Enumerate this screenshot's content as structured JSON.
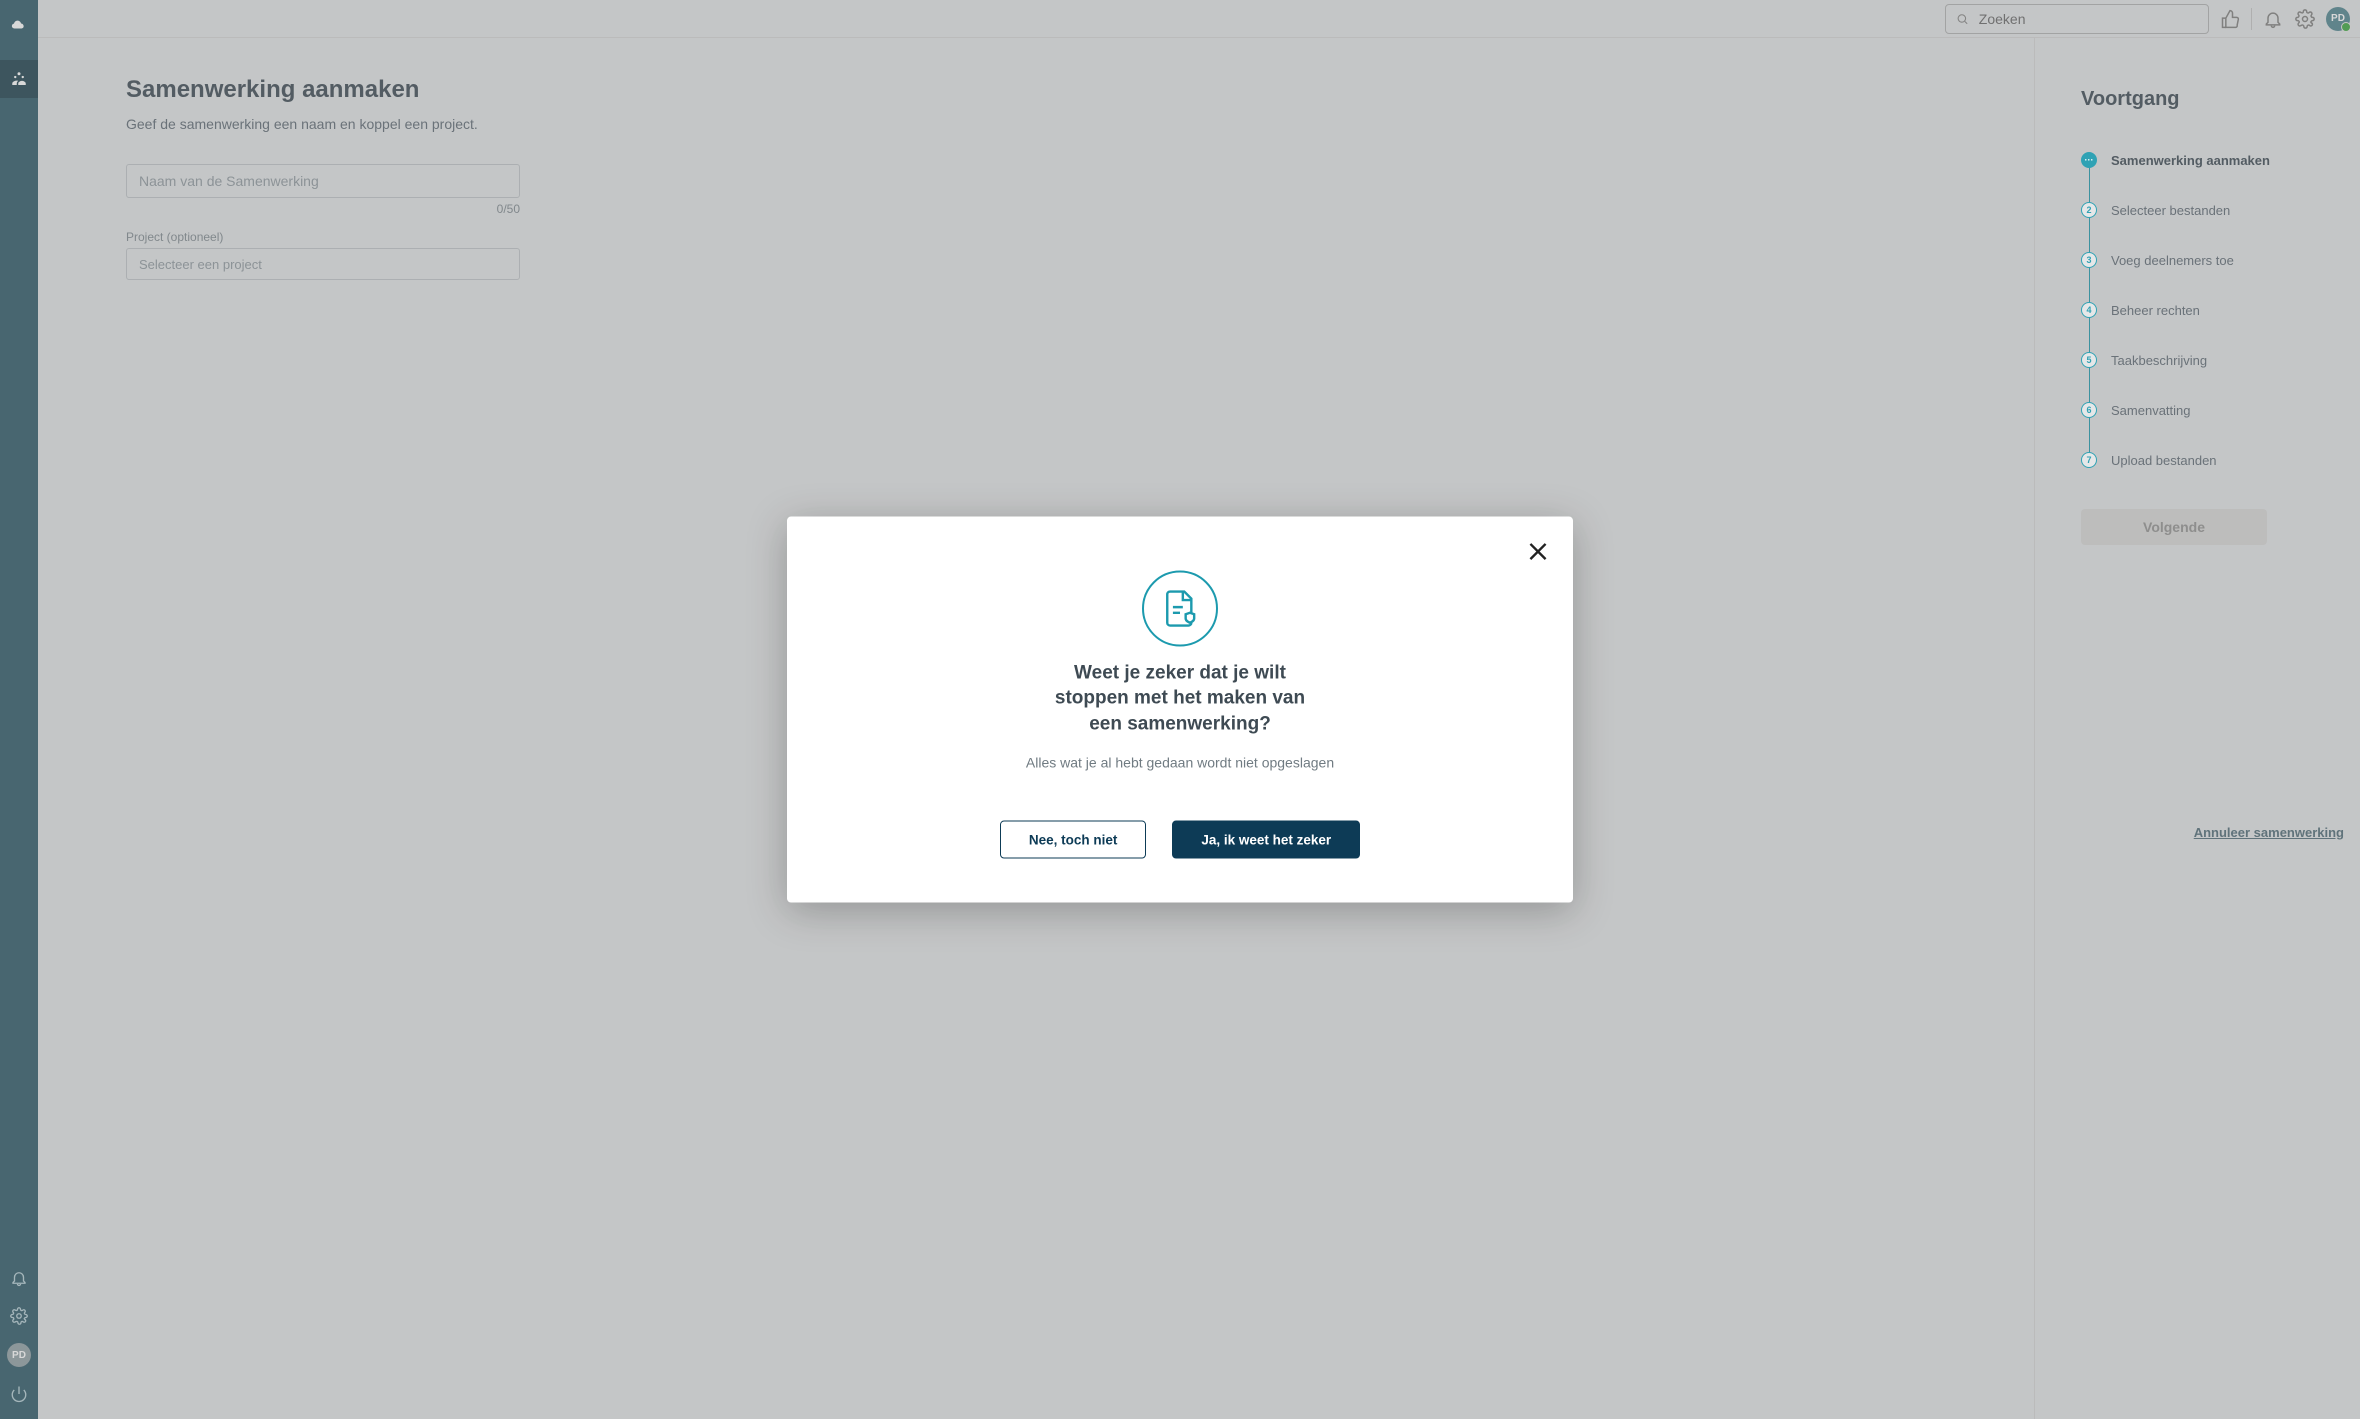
{
  "header": {
    "search_placeholder": "Zoeken",
    "avatar_initials": "PD"
  },
  "rail": {
    "avatar_initials": "PD"
  },
  "main": {
    "title": "Samenwerking aanmaken",
    "subtitle": "Geef de samenwerking een naam en koppel een project.",
    "name_placeholder": "Naam van de Samenwerking",
    "name_counter": "0/50",
    "project_label": "Project (optioneel)",
    "project_placeholder": "Selecteer een project"
  },
  "progress": {
    "title": "Voortgang",
    "steps": [
      {
        "num": "···",
        "label": "Samenwerking aanmaken"
      },
      {
        "num": "2",
        "label": "Selecteer bestanden"
      },
      {
        "num": "3",
        "label": "Voeg deelnemers toe"
      },
      {
        "num": "4",
        "label": "Beheer rechten"
      },
      {
        "num": "5",
        "label": "Taakbeschrijving"
      },
      {
        "num": "6",
        "label": "Samenvatting"
      },
      {
        "num": "7",
        "label": "Upload bestanden"
      }
    ],
    "next_label": "Volgende",
    "cancel_label": "Annuleer samenwerking"
  },
  "modal": {
    "title": "Weet je zeker dat je wilt stoppen met het maken van een samenwerking?",
    "body": "Alles wat je al hebt gedaan wordt niet opgeslagen",
    "secondary": "Nee, toch niet",
    "primary": "Ja, ik weet het zeker"
  }
}
